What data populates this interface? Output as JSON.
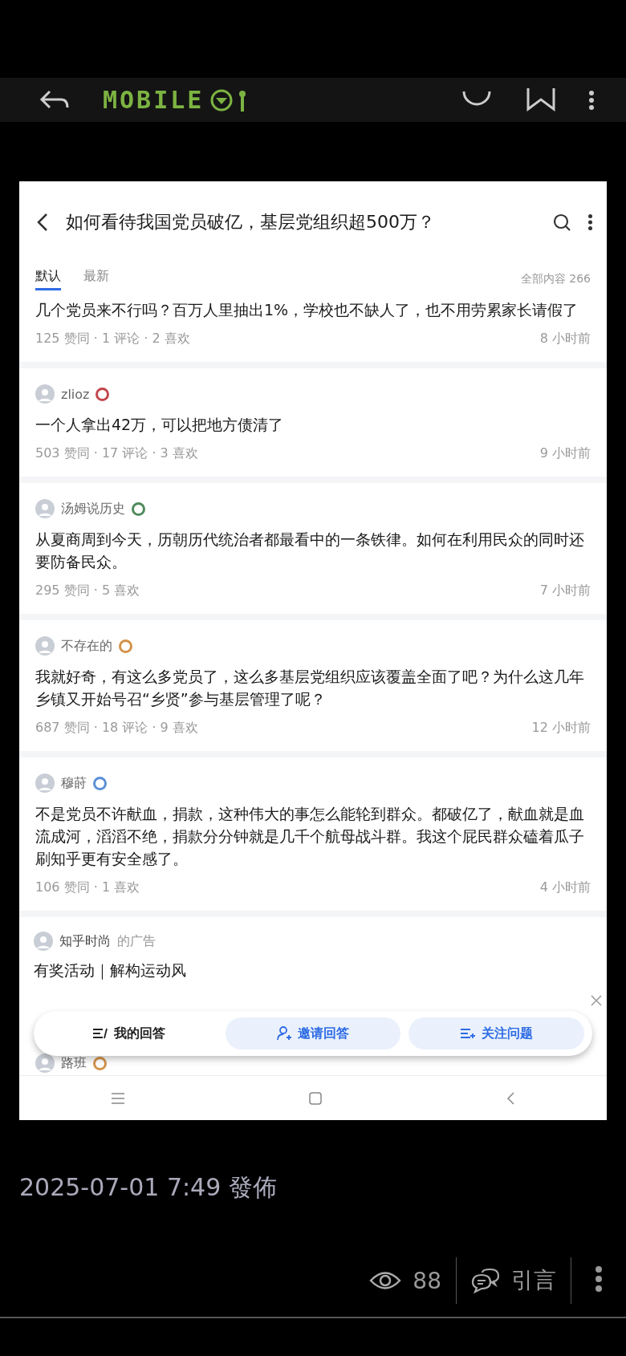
{
  "top_bar": {
    "logo_text": "MOBILE"
  },
  "question": {
    "title": "如何看待我国党员破亿，基层党组织超500万？",
    "tabs": [
      {
        "label": "默认",
        "selected": true
      },
      {
        "label": "最新",
        "selected": false
      }
    ],
    "total": "全部内容 266"
  },
  "answers": [
    {
      "kind": "continued",
      "text": "几个党员来不行吗？百万人里抽出1%，学校也不缺人了，也不用劳累家长请假了",
      "stats": "125 赞同 · 1 评论 · 2 喜欢",
      "time": "8 小时前"
    },
    {
      "kind": "full",
      "author": "zlioz",
      "color": "#c2464b",
      "text": "一个人拿出42万，可以把地方债清了",
      "stats": "503 赞同 · 17 评论 · 3 喜欢",
      "time": "9 小时前"
    },
    {
      "kind": "full",
      "author": "汤姆说历史",
      "color": "#4f8a5c",
      "text": "从夏商周到今天，历朝历代统治者都最看中的一条铁律。如何在利用民众的同时还要防备民众。",
      "stats": "295 赞同 · 5 喜欢",
      "time": "7 小时前"
    },
    {
      "kind": "full",
      "author": "不存在的",
      "color": "#d4924a",
      "text": "我就好奇，有这么多党员了，这么多基层党组织应该覆盖全面了吧？为什么这几年乡镇又开始号召“乡贤”参与基层管理了呢？",
      "stats": "687 赞同 · 18 评论 · 9 喜欢",
      "time": "12 小时前"
    },
    {
      "kind": "full",
      "author": "穆莳",
      "color": "#5b8fd6",
      "text": "不是党员不许献血，捐款，这种伟大的事怎么能轮到群众。都破亿了，献血就是血流成河，滔滔不绝，捐款分分钟就是几千个航母战斗群。我这个屁民群众磕着瓜子刷知乎更有安全感了。",
      "stats": "106 赞同 · 1 喜欢",
      "time": "4 小时前"
    }
  ],
  "ad": {
    "advertiser": "知乎时尚",
    "suffix": "的广告",
    "title": "有奖活动｜解构运动风"
  },
  "action_bar": {
    "buttons": [
      {
        "label": "我的回答",
        "kind": "plain"
      },
      {
        "label": "邀请回答",
        "kind": "accent"
      },
      {
        "label": "关注问题",
        "kind": "accent"
      }
    ]
  },
  "next_author": {
    "author": "路班",
    "color": "#d4924a"
  },
  "post": {
    "date": "2025-07-01 7:49 發佈",
    "views": "88",
    "quote": "引言"
  }
}
